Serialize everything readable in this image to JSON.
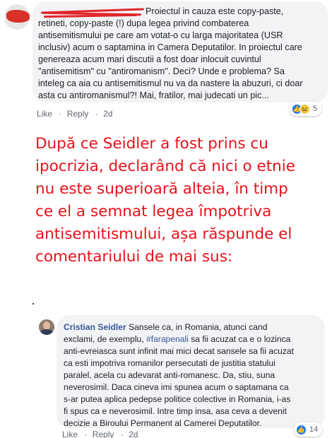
{
  "comment1": {
    "lines": [
      "Proiectul in cauza este copy-paste,",
      "retineti, copy-paste (!) dupa legea privind combaterea",
      "antisemitismului pe care am votat-o cu larga majoritatea (USR",
      "inclusiv) acum o saptamina in Camera Deputatilor. In proiectul care",
      "genereaza acum mari discutii a fost doar inlocuit cuvintul",
      "\"antisemitism\" cu \"antiromanism\". Deci? Unde e problema? Sa",
      "inteleg ca aia cu antisemitismul nu va da nastere la abuzuri, ci doar",
      "asta cu antiromanismul?! Mai, fratilor, mai judecati un pic..."
    ],
    "actions": {
      "like": "Like",
      "reply": "Reply",
      "separator": "·",
      "time": "2d"
    },
    "reactions": {
      "icons": [
        "like-icon",
        "haha-icon"
      ],
      "count": "5"
    },
    "colors": {
      "redaction": "#e0262b"
    }
  },
  "caption": {
    "lines": [
      "După ce Seidler a fost prins cu",
      "ipocrizia, declarând că nici o etnie",
      "nu este superioară alteia, în timp",
      "ce el a semnat legea împotriva",
      "antisemitismului, așa răspunde el",
      "comentariului de mai sus:"
    ],
    "color": "#e8121a"
  },
  "comment2": {
    "author": "Cristian Seidler",
    "line1_a": "Sansele ca, in Romania, atunci cand",
    "line2_a": "exclami, de exemplu,",
    "hashtag": "#farapenali",
    "line2_b": "sa fii acuzat ca e o lozinca",
    "lines": [
      "anti-evreiasca sunt infinit mai mici decat sansele sa fii acuzat",
      "ca esti impotriva romanilor persecutati de justitia statului",
      "paralel, acela cu adevarat anti-romanesc. Da, stiu, suna",
      "neverosimil. Daca cineva imi spunea acum o saptamana ca",
      "s-ar putea aplica pedepse politice colective in Romania, i-as",
      "fi spus ca e neverosimil. Intre timp insa, asa ceva a devenit",
      "decizie a Biroului Permanent al Camerei Deputatilor."
    ],
    "actions": {
      "like": "Like",
      "reply": "Reply",
      "separator": "·",
      "time": "2d"
    },
    "reactions": {
      "icons": [
        "like-icon"
      ],
      "count": "14"
    },
    "colors": {
      "link": "#385898"
    }
  }
}
